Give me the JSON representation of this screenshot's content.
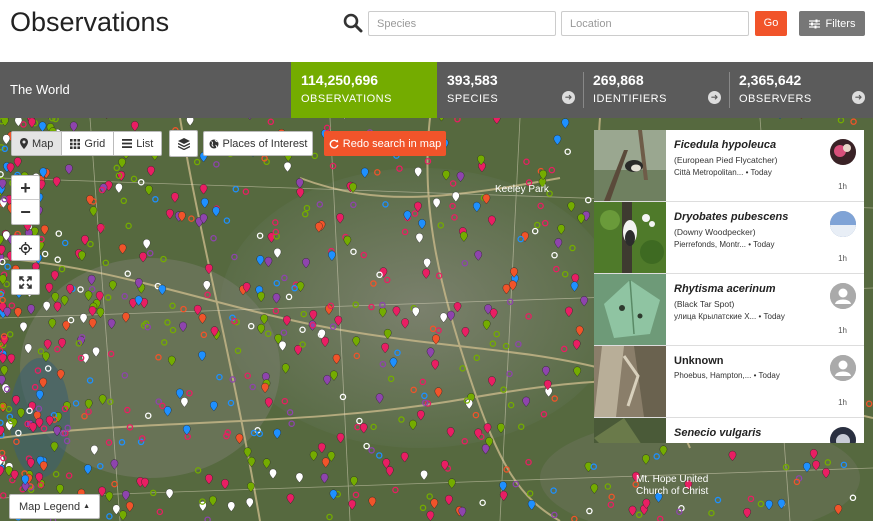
{
  "header": {
    "title": "Observations",
    "species_placeholder": "Species",
    "location_placeholder": "Location",
    "go_label": "Go",
    "filters_label": "Filters",
    "accent": "#f1542a"
  },
  "stats": {
    "place": "The World",
    "items": [
      {
        "value": "114,250,696",
        "label": "OBSERVATIONS"
      },
      {
        "value": "393,583",
        "label": "SPECIES"
      },
      {
        "value": "269,868",
        "label": "IDENTIFIERS"
      },
      {
        "value": "2,365,642",
        "label": "OBSERVERS"
      }
    ],
    "active_color": "#74ac00"
  },
  "map": {
    "view_tabs": [
      {
        "label": "Map",
        "icon": "map-marker-icon"
      },
      {
        "label": "Grid",
        "icon": "grid-icon"
      },
      {
        "label": "List",
        "icon": "list-icon"
      }
    ],
    "places_label": "Places of Interest",
    "redo_label": "Redo search in map",
    "legend_label": "Map Legend",
    "zoom_in": "+",
    "zoom_out": "−",
    "map_labels": [
      {
        "text": "Keeley Park"
      },
      {
        "text": "Mt. Hope United"
      },
      {
        "text": "Church of Christ"
      }
    ]
  },
  "observations": [
    {
      "name": "Ficedula hypoleuca",
      "common": "(European Pied Flycatcher)",
      "place": "Città Metropolitan...",
      "when": "• Today",
      "age": "1h",
      "italic": true
    },
    {
      "name": "Dryobates pubescens",
      "common": "(Downy Woodpecker)",
      "place": "Pierrefonds, Montr...",
      "when": "• Today",
      "age": "1h",
      "italic": true
    },
    {
      "name": "Rhytisma acerinum",
      "common": "(Black Tar Spot)",
      "place": "улица Крылатские Х...",
      "when": "• Today",
      "age": "1h",
      "italic": true
    },
    {
      "name": "Unknown",
      "common": "",
      "place": "Phoebus, Hampton,...",
      "when": "• Today",
      "age": "1h",
      "italic": false
    },
    {
      "name": "Senecio vulgaris",
      "common": "",
      "place": "",
      "when": "",
      "age": "",
      "italic": true
    }
  ]
}
